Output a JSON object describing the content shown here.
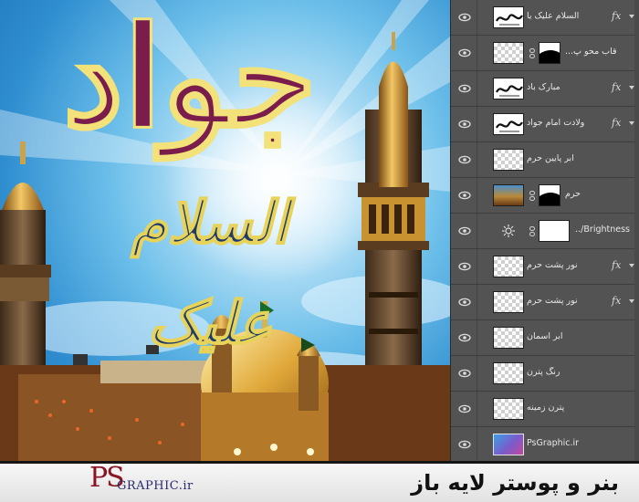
{
  "layers_panel": {
    "layers": [
      {
        "name": "السلام علیک یا",
        "thumb": "text-thumb",
        "fx": true,
        "mask": false
      },
      {
        "name": "قاب محو پ...",
        "thumb": "checker",
        "fx": false,
        "mask": true
      },
      {
        "name": "مبارک باد",
        "thumb": "text-thumb",
        "fx": true,
        "mask": false
      },
      {
        "name": "ولادت امام جواد",
        "thumb": "text-thumb",
        "fx": true,
        "mask": false
      },
      {
        "name": "ابر پایین حرم",
        "thumb": "checker",
        "fx": false,
        "mask": false
      },
      {
        "name": "حرم",
        "thumb": "photo",
        "fx": false,
        "mask": true
      },
      {
        "name": "Brightness/...",
        "thumb": "white",
        "fx": false,
        "mask": false,
        "adjustment": true
      },
      {
        "name": "نور پشت حرم",
        "thumb": "checker",
        "fx": true,
        "mask": false
      },
      {
        "name": "نور پشت حرم",
        "thumb": "checker",
        "fx": true,
        "mask": false
      },
      {
        "name": "ابر آسمان",
        "thumb": "checker",
        "fx": false,
        "mask": false
      },
      {
        "name": "رنگ پترن",
        "thumb": "checker",
        "fx": false,
        "mask": false
      },
      {
        "name": "پترن زمینه",
        "thumb": "checker",
        "fx": false,
        "mask": false
      },
      {
        "name": "PsGraphic.ir",
        "thumb": "grad",
        "fx": false,
        "mask": false
      }
    ],
    "fx_label": "fx"
  },
  "banner": {
    "logo_ps": "PS",
    "logo_graphic": "GRAPHIC.ir",
    "title": "بنر و پوستر لایه باز"
  },
  "poster": {
    "headline": "جواد",
    "subline": "السلام علیک"
  },
  "colors": {
    "panel_bg": "#535353",
    "headline": "#7a1d4c",
    "subline": "#1f3b6a",
    "gold": "#d9a441"
  }
}
